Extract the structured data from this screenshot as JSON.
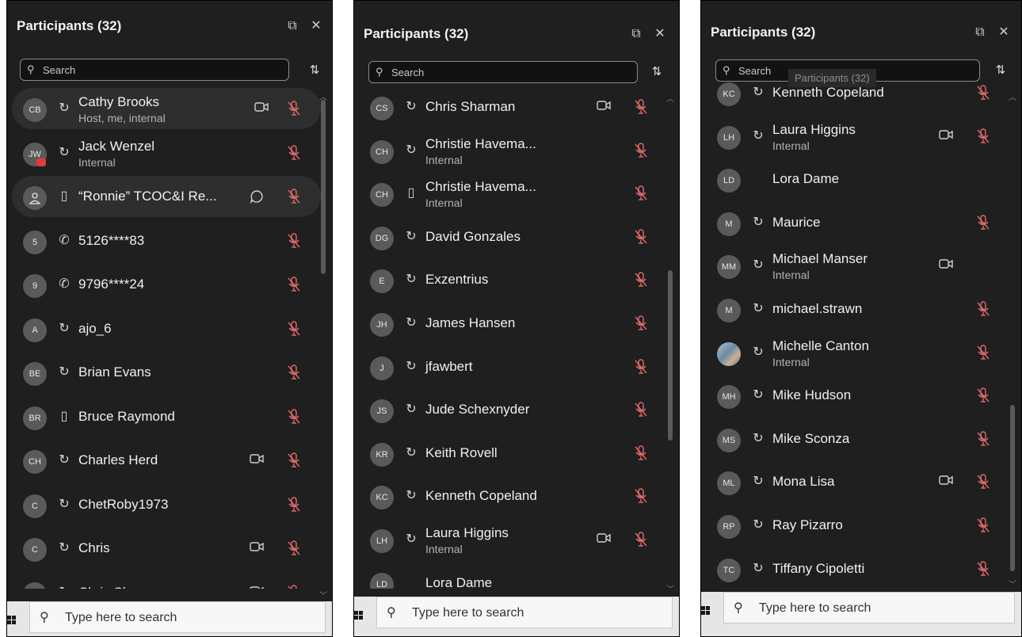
{
  "colors": {
    "panel_bg": "#1f1f1f",
    "row_highlight": "#2e2e2e",
    "muted_mic": "#e06b6b",
    "avatar_bg": "#5a5a5a"
  },
  "panels": [
    {
      "title": "Participants (32)",
      "search_placeholder": "Search",
      "taskbar_search": "Type here to search",
      "rows": [
        {
          "initials": "CB",
          "status": "headset",
          "name": "Cathy Brooks",
          "sub": "Host, me, internal",
          "camera": true,
          "mic": "muted",
          "highlight": true
        },
        {
          "initials": "JW",
          "status": "headset",
          "name": "Jack Wenzel",
          "sub": "Internal",
          "mic": "muted",
          "badge": true
        },
        {
          "initials": "",
          "status": "device",
          "name": "“Ronnie” TCOC&I Re...",
          "chat": true,
          "mic": "muted",
          "highlight": true,
          "person": true
        },
        {
          "initials": "5",
          "status": "phone",
          "name": "5126****83",
          "mic": "muted"
        },
        {
          "initials": "9",
          "status": "phone",
          "name": "9796****24",
          "mic": "muted"
        },
        {
          "initials": "A",
          "status": "headset",
          "name": "ajo_6",
          "mic": "muted"
        },
        {
          "initials": "BE",
          "status": "headset",
          "name": "Brian Evans",
          "mic": "muted"
        },
        {
          "initials": "BR",
          "status": "device",
          "name": "Bruce Raymond",
          "mic": "muted"
        },
        {
          "initials": "CH",
          "status": "headset",
          "name": "Charles Herd",
          "camera": true,
          "mic": "muted"
        },
        {
          "initials": "C",
          "status": "headset",
          "name": "ChetRoby1973",
          "mic": "muted"
        },
        {
          "initials": "C",
          "status": "headset",
          "name": "Chris",
          "camera": true,
          "mic": "muted"
        },
        {
          "initials": "CS",
          "status": "headset",
          "name": "Chris Sharman",
          "camera": true,
          "mic": "muted"
        }
      ]
    },
    {
      "title": "Participants (32)",
      "search_placeholder": "Search",
      "taskbar_search": "Type here to search",
      "rows": [
        {
          "initials": "CS",
          "status": "headset",
          "name": "Chris Sharman",
          "camera": true,
          "mic": "muted"
        },
        {
          "initials": "CH",
          "status": "headset",
          "name": "Christie Havema...",
          "sub": "Internal",
          "mic": "muted"
        },
        {
          "initials": "CH",
          "status": "device",
          "name": "Christie Havema...",
          "sub": "Internal",
          "mic": "muted"
        },
        {
          "initials": "DG",
          "status": "headset",
          "name": "David Gonzales",
          "mic": "muted"
        },
        {
          "initials": "E",
          "status": "headset",
          "name": "Exzentrius",
          "mic": "muted"
        },
        {
          "initials": "JH",
          "status": "headset",
          "name": "James Hansen",
          "mic": "muted"
        },
        {
          "initials": "J",
          "status": "headset",
          "name": "jfawbert",
          "mic": "muted"
        },
        {
          "initials": "JS",
          "status": "headset",
          "name": "Jude Schexnyder",
          "mic": "muted"
        },
        {
          "initials": "KR",
          "status": "headset",
          "name": "Keith Rovell",
          "mic": "muted"
        },
        {
          "initials": "KC",
          "status": "headset",
          "name": "Kenneth Copeland",
          "mic": "muted"
        },
        {
          "initials": "LH",
          "status": "headset",
          "name": "Laura Higgins",
          "sub": "Internal",
          "camera": true,
          "mic": "muted"
        },
        {
          "initials": "LD",
          "status": "none",
          "name": "Lora Dame"
        }
      ]
    },
    {
      "title": "Participants (32)",
      "search_placeholder": "Search",
      "ghost_label": "Participants (32)",
      "taskbar_search": "Type here to search",
      "rows": [
        {
          "initials": "KC",
          "status": "headset",
          "name": "Kenneth Copeland",
          "mic": "muted"
        },
        {
          "initials": "LH",
          "status": "headset",
          "name": "Laura Higgins",
          "sub": "Internal",
          "camera": true,
          "mic": "muted"
        },
        {
          "initials": "LD",
          "status": "none",
          "name": "Lora Dame"
        },
        {
          "initials": "M",
          "status": "headset",
          "name": "Maurice",
          "mic": "muted"
        },
        {
          "initials": "MM",
          "status": "headset",
          "name": "Michael Manser",
          "sub": "Internal",
          "camera": true
        },
        {
          "initials": "M",
          "status": "headset",
          "name": "michael.strawn",
          "mic": "muted"
        },
        {
          "initials": "",
          "status": "headset",
          "name": "Michelle Canton",
          "sub": "Internal",
          "mic": "muted",
          "photo": true
        },
        {
          "initials": "MH",
          "status": "headset",
          "name": "Mike Hudson",
          "mic": "muted"
        },
        {
          "initials": "MS",
          "status": "headset",
          "name": "Mike Sconza",
          "mic": "muted"
        },
        {
          "initials": "ML",
          "status": "headset",
          "name": "Mona Lisa",
          "camera": true,
          "mic": "muted"
        },
        {
          "initials": "RP",
          "status": "headset",
          "name": "Ray Pizarro",
          "mic": "muted"
        },
        {
          "initials": "TC",
          "status": "headset",
          "name": "Tiffany Cipoletti",
          "mic": "muted"
        }
      ]
    }
  ]
}
